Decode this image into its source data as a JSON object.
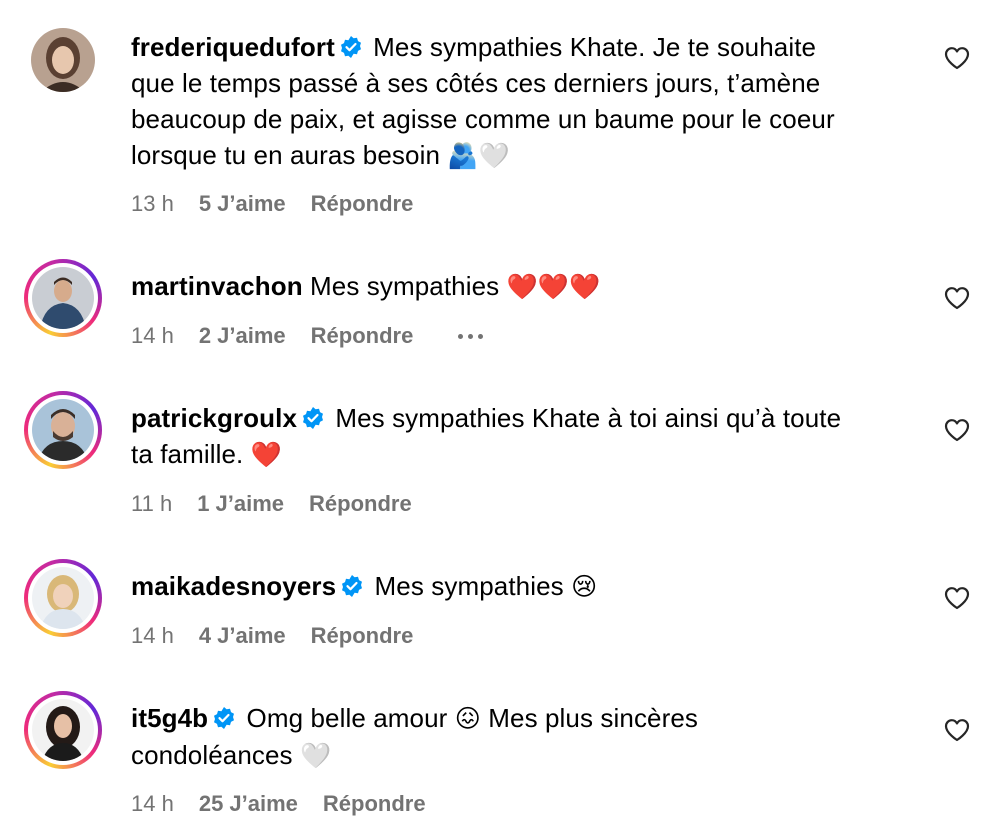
{
  "icons": {
    "verified": "verified-badge-icon",
    "like": "heart-outline-icon",
    "more": "ellipsis-icon"
  },
  "colors": {
    "meta_text": "#737373",
    "verified_blue": "#0095f6"
  },
  "comments": [
    {
      "username": "frederiquedufort",
      "verified": true,
      "text_lines": [
        "Mes sympathies Khate. Je te souhaite",
        "que le temps passé à ses côtés ces derniers jours, t’amène",
        "beaucoup de paix, et agisse comme un baume pour le coeur",
        "lorsque tu en auras besoin"
      ],
      "emoji": "🫂🤍",
      "time": "13 h",
      "likes": "5 J’aime",
      "reply": "Répondre"
    },
    {
      "username": "martinvachon",
      "verified": false,
      "text_lines": [
        "Mes sympathies"
      ],
      "emoji": "❤️❤️❤️",
      "time": "14 h",
      "likes": "2 J’aime",
      "reply": "Répondre"
    },
    {
      "username": "patrickgroulx",
      "verified": true,
      "text_lines": [
        "Mes sympathies Khate à toi ainsi qu’à toute",
        "ta famille."
      ],
      "emoji": "❤️",
      "time": "11 h",
      "likes": "1 J’aime",
      "reply": "Répondre"
    },
    {
      "username": "maikadesnoyers",
      "verified": true,
      "text_lines": [
        "Mes sympathies"
      ],
      "emoji": "😢",
      "time": "14 h",
      "likes": "4 J’aime",
      "reply": "Répondre"
    },
    {
      "username": "it5g4b",
      "verified": true,
      "text_lines": [
        "Omg belle amour",
        "Mes plus sincères",
        "condoléances"
      ],
      "emoji": "😖",
      "emoji_end": "🤍",
      "time": "14 h",
      "likes": "25 J’aime",
      "reply": "Répondre"
    }
  ]
}
